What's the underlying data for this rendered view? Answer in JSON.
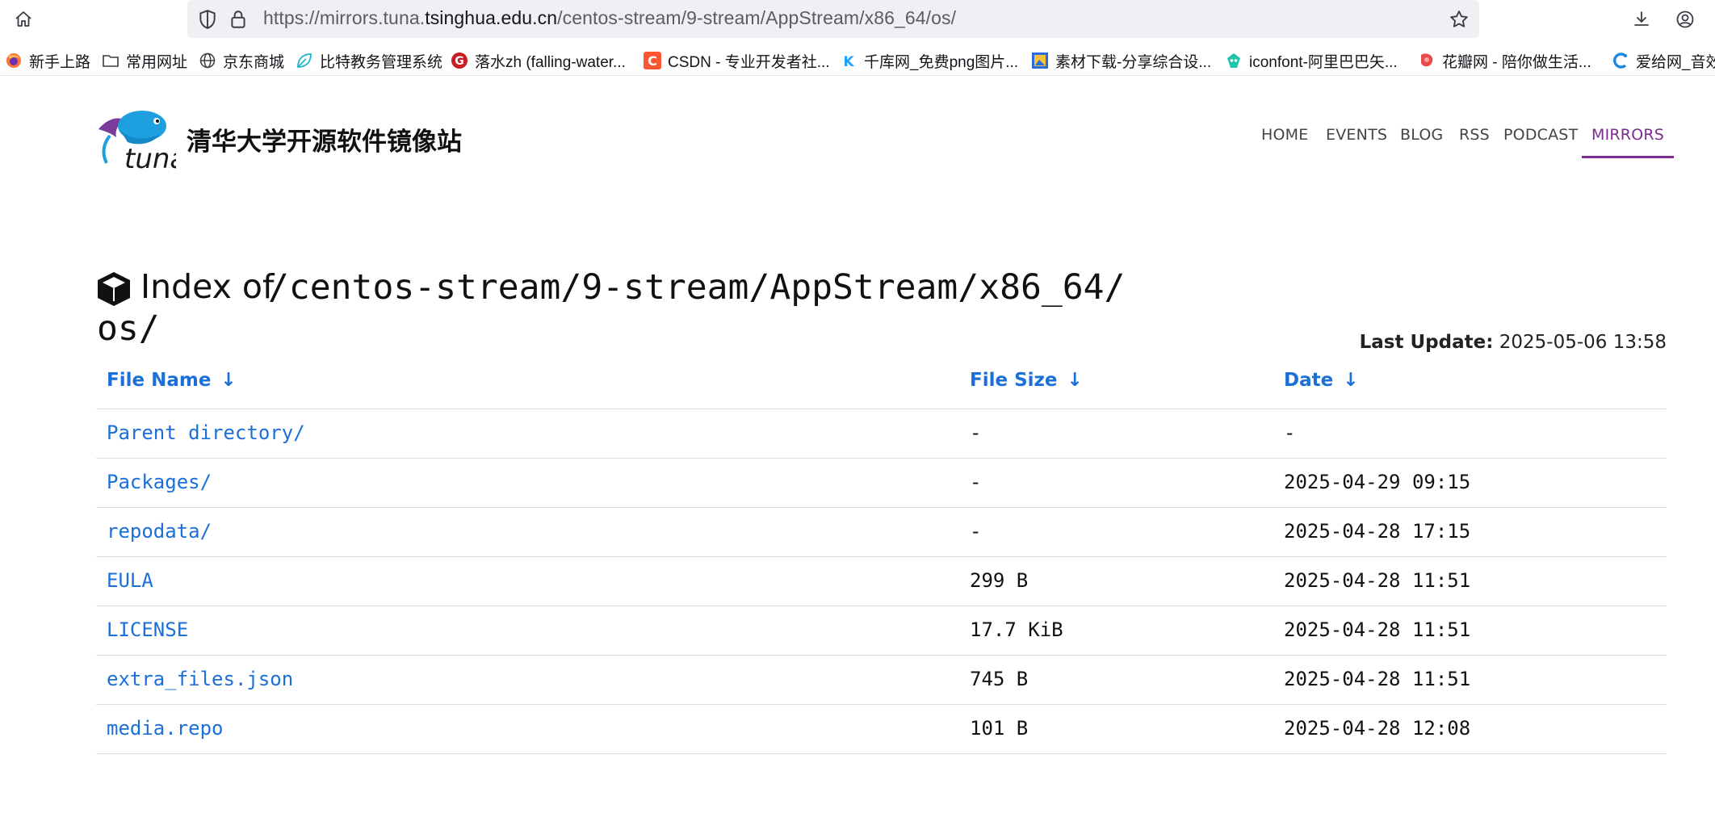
{
  "browser": {
    "url_prefix": "https://mirrors.tuna.",
    "url_host": "tsinghua.edu.cn",
    "url_path": "/centos-stream/9-stream/AppStream/x86_64/os/"
  },
  "bookmarks": [
    {
      "label": "新手上路",
      "icon": "firefox-icon"
    },
    {
      "label": "常用网址",
      "icon": "folder-icon"
    },
    {
      "label": "京东商城",
      "icon": "globe-icon"
    },
    {
      "label": "比特教务管理系统",
      "icon": "leaf-icon"
    },
    {
      "label": "落水zh (falling-water...",
      "icon": "gitee-icon"
    },
    {
      "label": "CSDN - 专业开发者社...",
      "icon": "csdn-icon"
    },
    {
      "label": "千库网_免费png图片...",
      "icon": "qianku-icon"
    },
    {
      "label": "素材下载-分享综合设...",
      "icon": "sucai-icon"
    },
    {
      "label": "iconfont-阿里巴巴矢...",
      "icon": "iconfont-icon"
    },
    {
      "label": "花瓣网 - 陪你做生活...",
      "icon": "huaban-icon"
    },
    {
      "label": "爱给网_音效",
      "icon": "aigei-icon"
    }
  ],
  "site": {
    "logo_text": "tuna",
    "title": "清华大学开源软件镜像站",
    "nav": [
      "HOME",
      "EVENTS",
      "BLOG",
      "RSS",
      "PODCAST",
      "MIRRORS"
    ],
    "active_nav": "MIRRORS"
  },
  "index": {
    "heading_prefix": "Index of",
    "path_line1": "/centos-stream/9-stream/AppStream/x86_64/",
    "path_line2": "os/",
    "last_update_label": "Last Update:",
    "last_update_value": "2025-05-06 13:58"
  },
  "table": {
    "headers": [
      "File Name",
      "File Size",
      "Date"
    ],
    "sort_arrow": "↓",
    "rows": [
      {
        "name": "Parent directory/",
        "size": "-",
        "date": "-"
      },
      {
        "name": "Packages/",
        "size": "-",
        "date": "2025-04-29 09:15"
      },
      {
        "name": "repodata/",
        "size": "-",
        "date": "2025-04-28 17:15"
      },
      {
        "name": "EULA",
        "size": "299 B",
        "date": "2025-04-28 11:51"
      },
      {
        "name": "LICENSE",
        "size": "17.7 KiB",
        "date": "2025-04-28 11:51"
      },
      {
        "name": "extra_files.json",
        "size": "745 B",
        "date": "2025-04-28 11:51"
      },
      {
        "name": "media.repo",
        "size": "101 B",
        "date": "2025-04-28 12:08"
      }
    ]
  },
  "colors": {
    "link": "#1a6fd8",
    "nav_active": "#7b2c8e",
    "urlbar_bg": "#f0f0f4"
  }
}
